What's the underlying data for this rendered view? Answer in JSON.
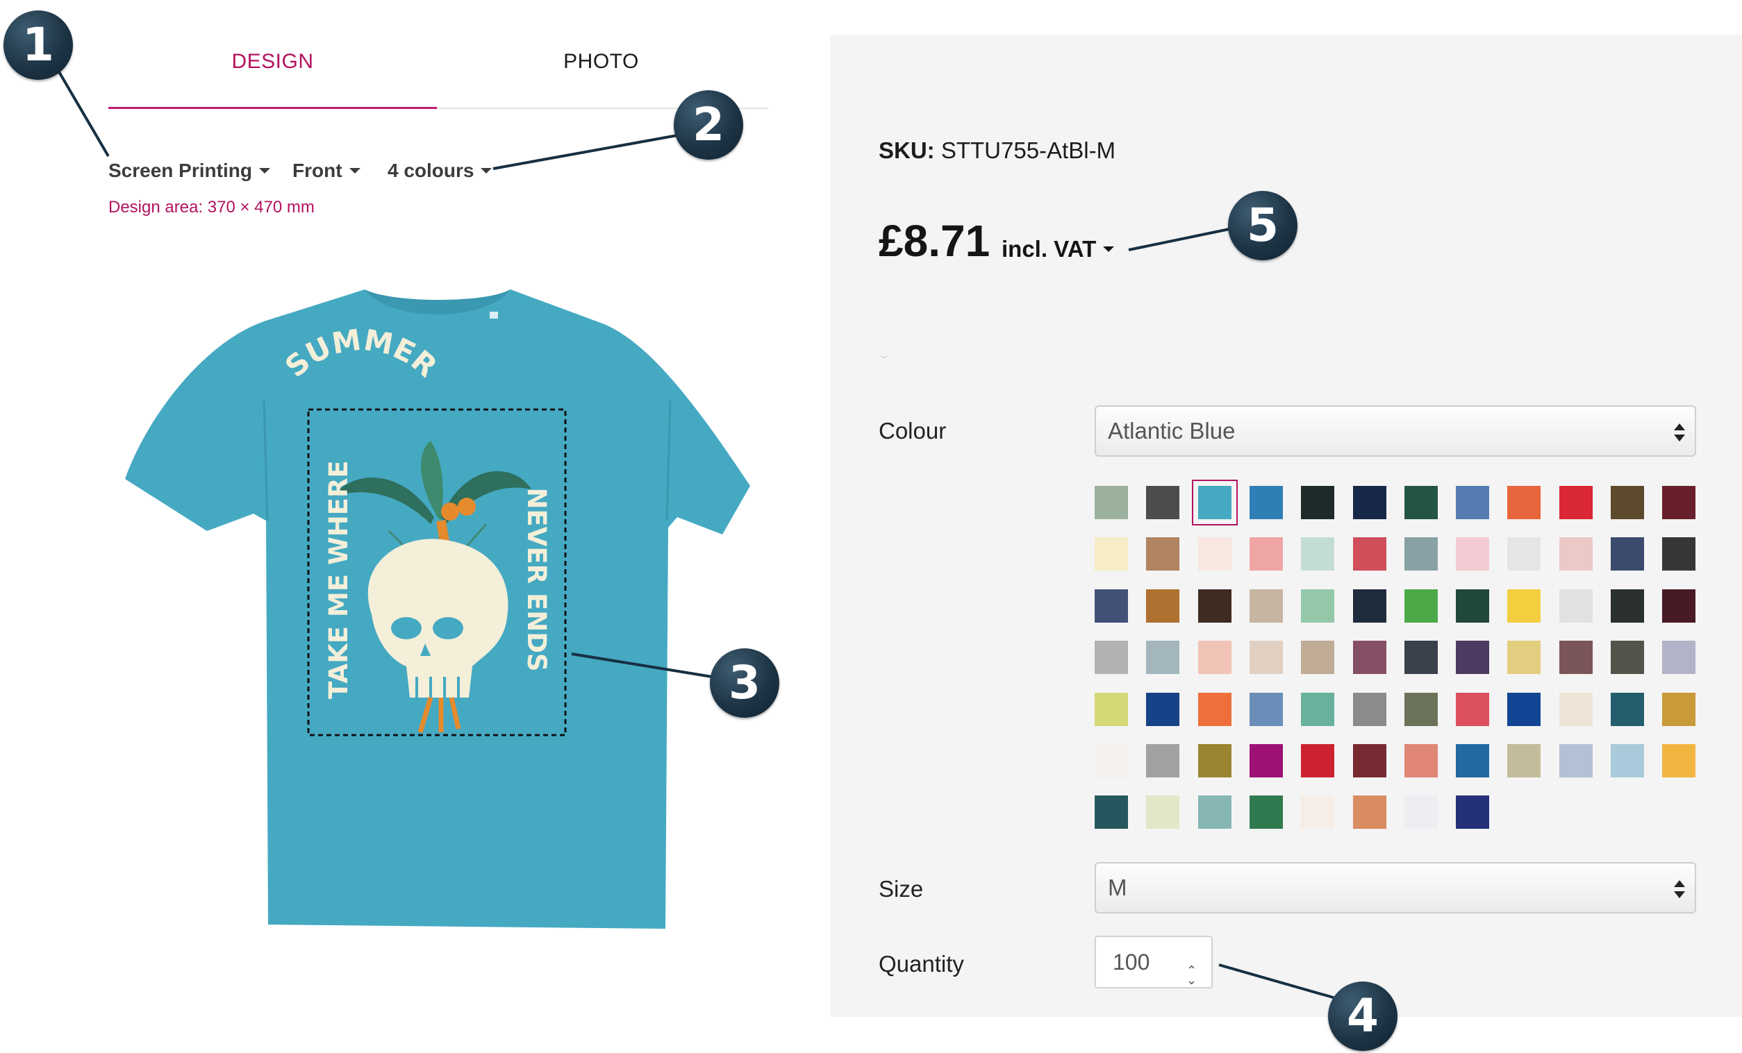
{
  "tabs": [
    {
      "label": "DESIGN",
      "active": true
    },
    {
      "label": "PHOTO",
      "active": false
    }
  ],
  "options": {
    "method": "Screen Printing",
    "side": "Front",
    "colours": "4 colours",
    "design_area": "Design area: 370 × 470 mm"
  },
  "artwork": {
    "text_left": "TAKE ME WHERE",
    "text_top": "SUMMER",
    "text_right": "NEVER ENDS"
  },
  "product": {
    "sku_label": "SKU:",
    "sku_value": "STTU755-AtBl-M",
    "price": "£8.71",
    "vat_label": "incl. VAT"
  },
  "colour_field": {
    "label": "Colour",
    "selected": "Atlantic Blue",
    "selected_index": 2,
    "swatches": [
      "#9cb09e",
      "#4c4c4c",
      "#45a9c2",
      "#2f7fb6",
      "#1f2a2a",
      "#172848",
      "#245444",
      "#557cb0",
      "#e8643a",
      "#d92734",
      "#5d4a2c",
      "#6a1f2c",
      "#f6ecc6",
      "#b08460",
      "#f8e6e1",
      "#eea5a4",
      "#c4ddd2",
      "#d04f5b",
      "#88a1a4",
      "#f3cbd2",
      "#e7e5e3",
      "#eac9c7",
      "#3c4b6d",
      "#353738",
      "#415178",
      "#b0702f",
      "#3f2b22",
      "#c7b5a2",
      "#93c8a9",
      "#1f2c3d",
      "#4da947",
      "#21483d",
      "#f3cf40",
      "#e2e2e4",
      "#29302f",
      "#481a24",
      "#b2b2b2",
      "#a3b6bd",
      "#f1c4b7",
      "#e1d0c2",
      "#bfab96",
      "#854f66",
      "#3a404c",
      "#4d3a62",
      "#e3cd7e",
      "#7a5558",
      "#52544a",
      "#b2b2c8",
      "#d6d777",
      "#174288",
      "#ee6f3c",
      "#698fb9",
      "#69b09d",
      "#8a8b8b",
      "#6b735a",
      "#dd505d",
      "#124594",
      "#ede4d7",
      "#245e6e",
      "#c99a38",
      "#f3f0ed",
      "#a1a1a2",
      "#9b8431",
      "#9c1173",
      "#cd2231",
      "#782932",
      "#df8677",
      "#226aa1",
      "#c3bc9b",
      "#b4c1d4",
      "#a9cada",
      "#f3b542",
      "#25585e",
      "#e1e7c8",
      "#86b7b5",
      "#307a4f",
      "#f6eee6",
      "#d98c61",
      "#eeeef2",
      "#24307a"
    ]
  },
  "size_field": {
    "label": "Size",
    "selected": "M"
  },
  "quantity_field": {
    "label": "Quantity",
    "value": "100"
  },
  "callouts": [
    "1",
    "2",
    "3",
    "4",
    "5"
  ],
  "colors": {
    "accent": "#b3125f",
    "shirt": "#45a9c2",
    "badge": "#1d3445",
    "panel_bg": "#f4f4f4"
  }
}
